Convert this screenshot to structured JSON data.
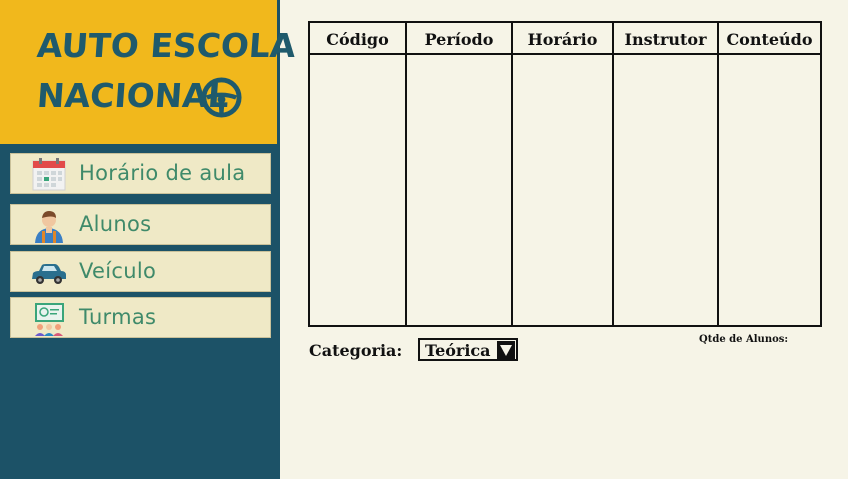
{
  "brand": {
    "line1": "AUTO ESCOLA",
    "line2": "NACIONAL",
    "icon": "steering-wheel-icon",
    "color": "#1f5a6c",
    "background": "#f1b81c"
  },
  "sidebar": {
    "background": "#1c5267",
    "items": [
      {
        "label": "Horário de aula",
        "icon": "calendar-icon"
      },
      {
        "label": "Alunos",
        "icon": "student-icon"
      },
      {
        "label": "Veículo",
        "icon": "car-icon"
      },
      {
        "label": "Turmas",
        "icon": "classroom-icon"
      }
    ]
  },
  "table": {
    "columns": [
      "Código",
      "Período",
      "Horário",
      "Instrutor",
      "Conteúdo"
    ],
    "rows": []
  },
  "category": {
    "label": "Categoria:",
    "value": "Teórica"
  },
  "students_count": {
    "label": "Qtde de Alunos:"
  }
}
